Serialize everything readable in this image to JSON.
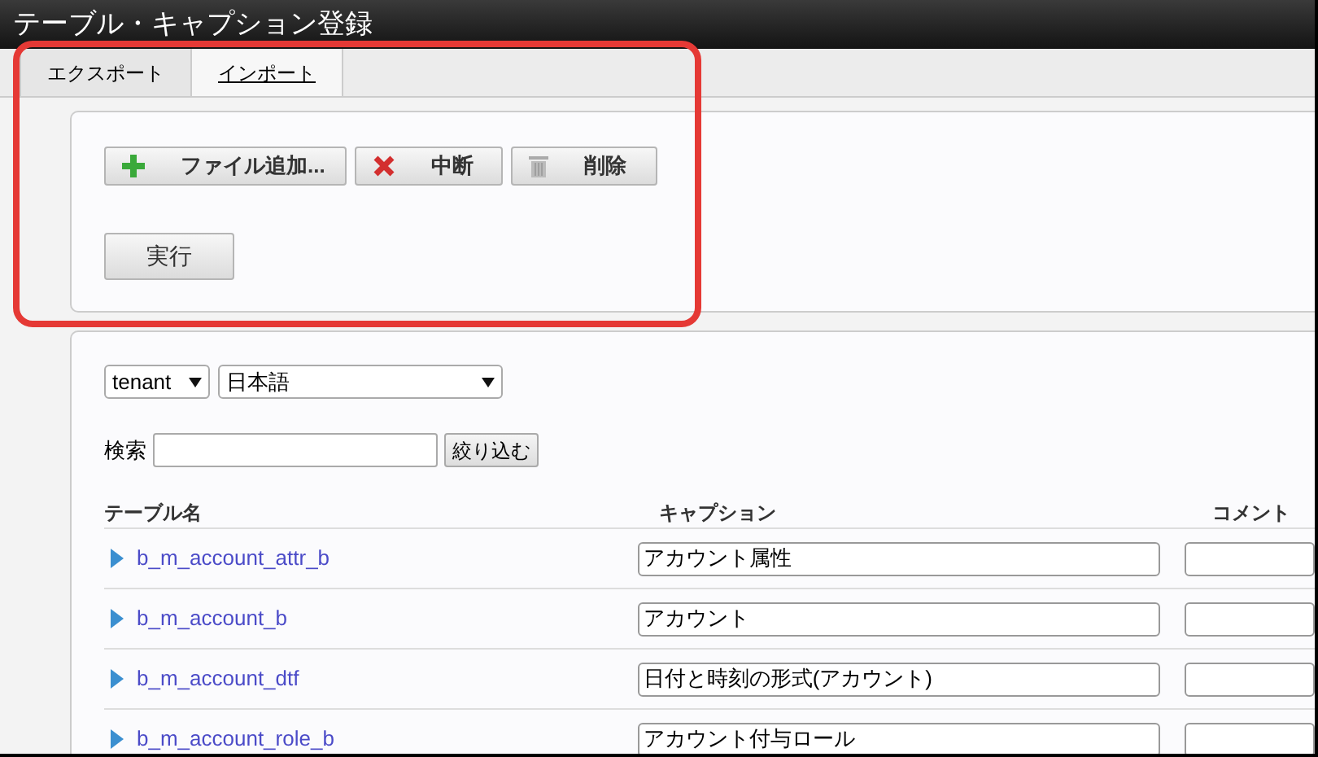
{
  "window": {
    "title": "テーブル・キャプション登録"
  },
  "tabs": [
    {
      "label": "エクスポート",
      "selected": false
    },
    {
      "label": "インポート",
      "selected": true
    }
  ],
  "import_buttons": [
    {
      "kind": "add",
      "label": "ファイル追加..."
    },
    {
      "kind": "cancel",
      "label": "中断"
    },
    {
      "kind": "delete",
      "label": "削除"
    }
  ],
  "run_button": "実行",
  "filters": {
    "tenant_select": "tenant",
    "language_select": "日本語",
    "search_label": "検索",
    "filter_button": "絞り込む"
  },
  "table": {
    "columns": [
      "テーブル名",
      "キャプション",
      "コメント"
    ],
    "rows": [
      {
        "name": "b_m_account_attr_b",
        "caption": "アカウント属性"
      },
      {
        "name": "b_m_account_b",
        "caption": "アカウント"
      },
      {
        "name": "b_m_account_dtf",
        "caption": "日付と時刻の形式(アカウント)"
      },
      {
        "name": "b_m_account_role_b",
        "caption": "アカウント付与ロール"
      }
    ]
  }
}
